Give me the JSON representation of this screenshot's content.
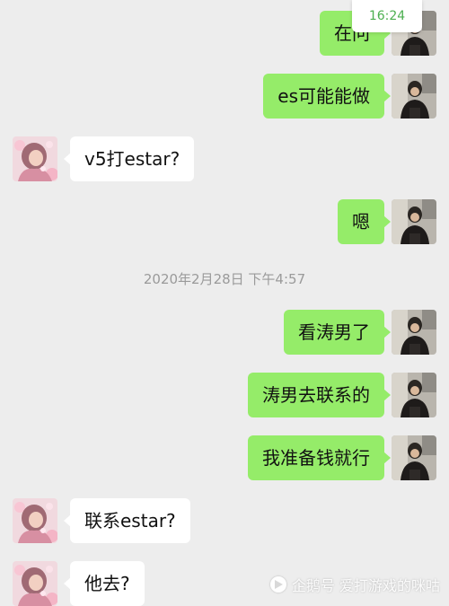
{
  "status_time": "16:24",
  "timestamp": "2020年2月28日 下午4:57",
  "messages": [
    {
      "side": "out",
      "text": "在问"
    },
    {
      "side": "out",
      "text": "es可能能做"
    },
    {
      "side": "in",
      "text": "v5打estar?"
    },
    {
      "side": "out",
      "text": "嗯"
    },
    {
      "side": "out",
      "text": "看涛男了"
    },
    {
      "side": "out",
      "text": "涛男去联系的"
    },
    {
      "side": "out",
      "text": "我准备钱就行"
    },
    {
      "side": "in",
      "text": "联系estar?"
    },
    {
      "side": "in",
      "text": "他去?"
    }
  ],
  "watermark": "企鹅号 爱打游戏的咪咕",
  "colors": {
    "background": "#ededed",
    "outgoing_bubble": "#95ec69",
    "incoming_bubble": "#ffffff",
    "badge_text": "#4caf50"
  }
}
